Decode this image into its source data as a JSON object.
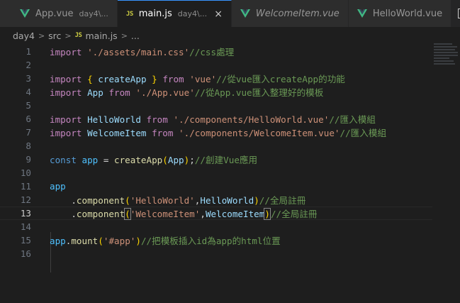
{
  "tabs": [
    {
      "name": "App.vue",
      "desc": "day4\\...",
      "icon": "vue-icon",
      "active": false,
      "italic": false
    },
    {
      "name": "main.js",
      "desc": "day4\\...",
      "icon": "js-icon",
      "active": true,
      "italic": false
    },
    {
      "name": "WelcomeItem.vue",
      "desc": "",
      "icon": "vue-icon",
      "active": false,
      "italic": true
    },
    {
      "name": "HelloWorld.vue",
      "desc": "",
      "icon": "vue-icon",
      "active": false,
      "italic": false
    }
  ],
  "js_icon_text": "JS",
  "close_glyph": "×",
  "breadcrumb": {
    "items": [
      "day4",
      "src",
      "main.js",
      "..."
    ],
    "separator": ">"
  },
  "lines": [
    {
      "n": "1",
      "tokens": [
        [
          "kw2",
          "import"
        ],
        [
          "t",
          " "
        ],
        [
          "str",
          "'./assets/main.css'"
        ],
        [
          "cm",
          "//css處理"
        ]
      ]
    },
    {
      "n": "2",
      "tokens": []
    },
    {
      "n": "3",
      "tokens": [
        [
          "kw2",
          "import"
        ],
        [
          "t",
          " "
        ],
        [
          "br1",
          "{"
        ],
        [
          "t",
          " "
        ],
        [
          "var",
          "createApp"
        ],
        [
          "t",
          " "
        ],
        [
          "br1",
          "}"
        ],
        [
          "t",
          " "
        ],
        [
          "kw2",
          "from"
        ],
        [
          "t",
          " "
        ],
        [
          "str",
          "'vue'"
        ],
        [
          "cm",
          "//從vue匯入createApp的功能"
        ]
      ]
    },
    {
      "n": "4",
      "tokens": [
        [
          "kw2",
          "import"
        ],
        [
          "t",
          " "
        ],
        [
          "var",
          "App"
        ],
        [
          "t",
          " "
        ],
        [
          "kw2",
          "from"
        ],
        [
          "t",
          " "
        ],
        [
          "str",
          "'./App.vue'"
        ],
        [
          "cm",
          "//從App.vue匯入整理好的模板"
        ]
      ]
    },
    {
      "n": "5",
      "tokens": []
    },
    {
      "n": "6",
      "tokens": [
        [
          "kw2",
          "import"
        ],
        [
          "t",
          " "
        ],
        [
          "var",
          "HelloWorld"
        ],
        [
          "t",
          " "
        ],
        [
          "kw2",
          "from"
        ],
        [
          "t",
          " "
        ],
        [
          "str",
          "'./components/HelloWorld.vue'"
        ],
        [
          "cm",
          "//匯入模組"
        ]
      ]
    },
    {
      "n": "7",
      "tokens": [
        [
          "kw2",
          "import"
        ],
        [
          "t",
          " "
        ],
        [
          "var",
          "WelcomeItem"
        ],
        [
          "t",
          " "
        ],
        [
          "kw2",
          "from"
        ],
        [
          "t",
          " "
        ],
        [
          "str",
          "'./components/WelcomeItem.vue'"
        ],
        [
          "cm",
          "//匯入模組"
        ]
      ]
    },
    {
      "n": "8",
      "tokens": []
    },
    {
      "n": "9",
      "tokens": [
        [
          "kw",
          "const"
        ],
        [
          "t",
          " "
        ],
        [
          "const",
          "app"
        ],
        [
          "t",
          " = "
        ],
        [
          "fn",
          "createApp"
        ],
        [
          "br1",
          "("
        ],
        [
          "var",
          "App"
        ],
        [
          "br1",
          ")"
        ],
        [
          "t",
          ";"
        ],
        [
          "cm",
          "//創建Vue應用"
        ]
      ]
    },
    {
      "n": "10",
      "tokens": []
    },
    {
      "n": "11",
      "tokens": [
        [
          "const",
          "app"
        ]
      ]
    },
    {
      "n": "12",
      "tokens": [
        [
          "t",
          "    ."
        ],
        [
          "fn",
          "component"
        ],
        [
          "br1",
          "("
        ],
        [
          "str",
          "'HelloWorld'"
        ],
        [
          "t",
          ","
        ],
        [
          "var",
          "HelloWorld"
        ],
        [
          "br1",
          ")"
        ],
        [
          "cm",
          "//全局註冊"
        ]
      ]
    },
    {
      "n": "13",
      "tokens": [
        [
          "t",
          "    ."
        ],
        [
          "fn",
          "component"
        ],
        [
          "br1",
          "("
        ],
        [
          "str",
          "'WelcomeItem'"
        ],
        [
          "t",
          ","
        ],
        [
          "var",
          "WelcomeItem"
        ],
        [
          "br1",
          ")"
        ],
        [
          "cm",
          "//全局註冊"
        ]
      ],
      "current": true
    },
    {
      "n": "14",
      "tokens": []
    },
    {
      "n": "15",
      "tokens": [
        [
          "const",
          "app"
        ],
        [
          "t",
          "."
        ],
        [
          "fn",
          "mount"
        ],
        [
          "br1",
          "("
        ],
        [
          "str",
          "'#app'"
        ],
        [
          "br1",
          ")"
        ],
        [
          "cm",
          "//把模板插入id為app的html位置"
        ]
      ]
    },
    {
      "n": "16",
      "tokens": []
    }
  ],
  "colors": {
    "keyword": "#569cd6",
    "import_keyword": "#c586c0",
    "string": "#ce9178",
    "comment": "#6a9955",
    "function": "#dcdcaa",
    "variable": "#9cdcfe",
    "constant": "#4fc1ff",
    "bracket": "#ffd700",
    "vue_icon": "#41b883",
    "js_icon": "#cbcb41",
    "active_tab_border": "#3794ff"
  }
}
